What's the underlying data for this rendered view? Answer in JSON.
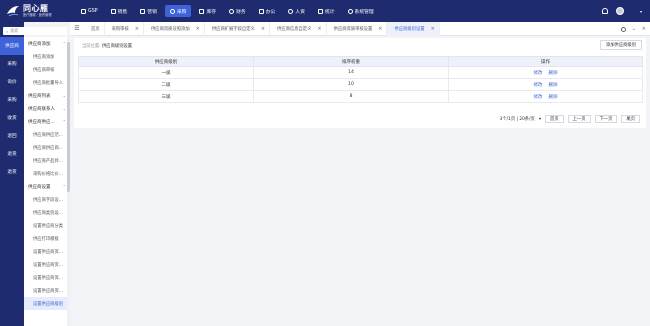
{
  "header": {
    "logo_title": "同心雁",
    "logo_subtitle": "医疗器械 · 医药管理",
    "nav": [
      {
        "label": "GSP",
        "icon": "document-icon",
        "active": false
      },
      {
        "label": "销售",
        "icon": "cart-icon",
        "active": false
      },
      {
        "label": "营销",
        "icon": "chart-icon",
        "active": false
      },
      {
        "label": "采购",
        "icon": "purchase-icon",
        "active": true
      },
      {
        "label": "库存",
        "icon": "box-icon",
        "active": false
      },
      {
        "label": "财务",
        "icon": "money-icon",
        "active": false
      },
      {
        "label": "办公",
        "icon": "briefcase-icon",
        "active": false
      },
      {
        "label": "人资",
        "icon": "person-icon",
        "active": false
      },
      {
        "label": "统计",
        "icon": "stats-icon",
        "active": false
      },
      {
        "label": "系统管理",
        "icon": "settings-icon",
        "active": false
      }
    ],
    "user_name": "",
    "user_caret": "▾"
  },
  "search": {
    "placeholder": "搜索"
  },
  "leftnav": [
    {
      "label": "供应商",
      "active": true
    },
    {
      "label": "采购",
      "active": false
    },
    {
      "label": "询价",
      "active": false
    },
    {
      "label": "采购",
      "active": false
    },
    {
      "label": "收货",
      "active": false
    },
    {
      "label": "退回",
      "active": false
    },
    {
      "label": "退货",
      "active": false
    },
    {
      "label": "退货",
      "active": false
    }
  ],
  "submenu": {
    "groups": [
      {
        "label": "供应商添加",
        "expanded": true,
        "items": [
          "供应商添加",
          "供应商审核",
          "供应商批量导入"
        ]
      },
      {
        "label": "供应商列表",
        "expanded": false,
        "items": []
      },
      {
        "label": "供应商联系人",
        "expanded": false,
        "items": []
      },
      {
        "label": "供应商供应...",
        "expanded": true,
        "items": [
          "供应商供应范...",
          "供应商供应商...",
          "供应商产品目...",
          "采购价格比价..."
        ]
      },
      {
        "label": "供应商设置",
        "expanded": true,
        "items": [
          "供应商字段设...",
          "供应商类别设...",
          "设置供应商分类",
          "供应打印模板",
          "设置供应商资...",
          "设置供应商资...",
          "设置供应商资...",
          "设置供应商资...",
          "设置供应商级别"
        ]
      }
    ],
    "active_item": "设置供应商级别"
  },
  "tabs": [
    {
      "label": "首页",
      "closable": false,
      "active": false
    },
    {
      "label": "采购审核",
      "closable": true,
      "active": false
    },
    {
      "label": "供应商资质证照添加",
      "closable": true,
      "active": false
    },
    {
      "label": "供应商扩展字段自定义",
      "closable": true,
      "active": false
    },
    {
      "label": "供应商信息自定义",
      "closable": true,
      "active": false
    },
    {
      "label": "供应商资质审核设置",
      "closable": true,
      "active": false
    },
    {
      "label": "供应商级别设置",
      "closable": true,
      "active": true
    }
  ],
  "breadcrumb": {
    "prefix": "当前位置:",
    "current": "供应商级别设置"
  },
  "add_button": "添加供应商级别",
  "table": {
    "headers": [
      "供应商级别",
      "排序权重",
      "操作"
    ],
    "rows": [
      {
        "level": "一级",
        "weight": "14",
        "edit": "修改",
        "delete": "删除"
      },
      {
        "level": "二级",
        "weight": "10",
        "edit": "修改",
        "delete": "删除"
      },
      {
        "level": "三级",
        "weight": "8",
        "edit": "修改",
        "delete": "删除"
      }
    ]
  },
  "pager": {
    "summary": "3个/1页 | 20条/页",
    "per_page_caret": "▾",
    "first": "首页",
    "prev": "上一页",
    "next": "下一页",
    "last": "尾页"
  },
  "colors": {
    "header_bg": "#1e2b6f",
    "accent": "#3e63d8",
    "page_bg": "#f3f4f8"
  }
}
